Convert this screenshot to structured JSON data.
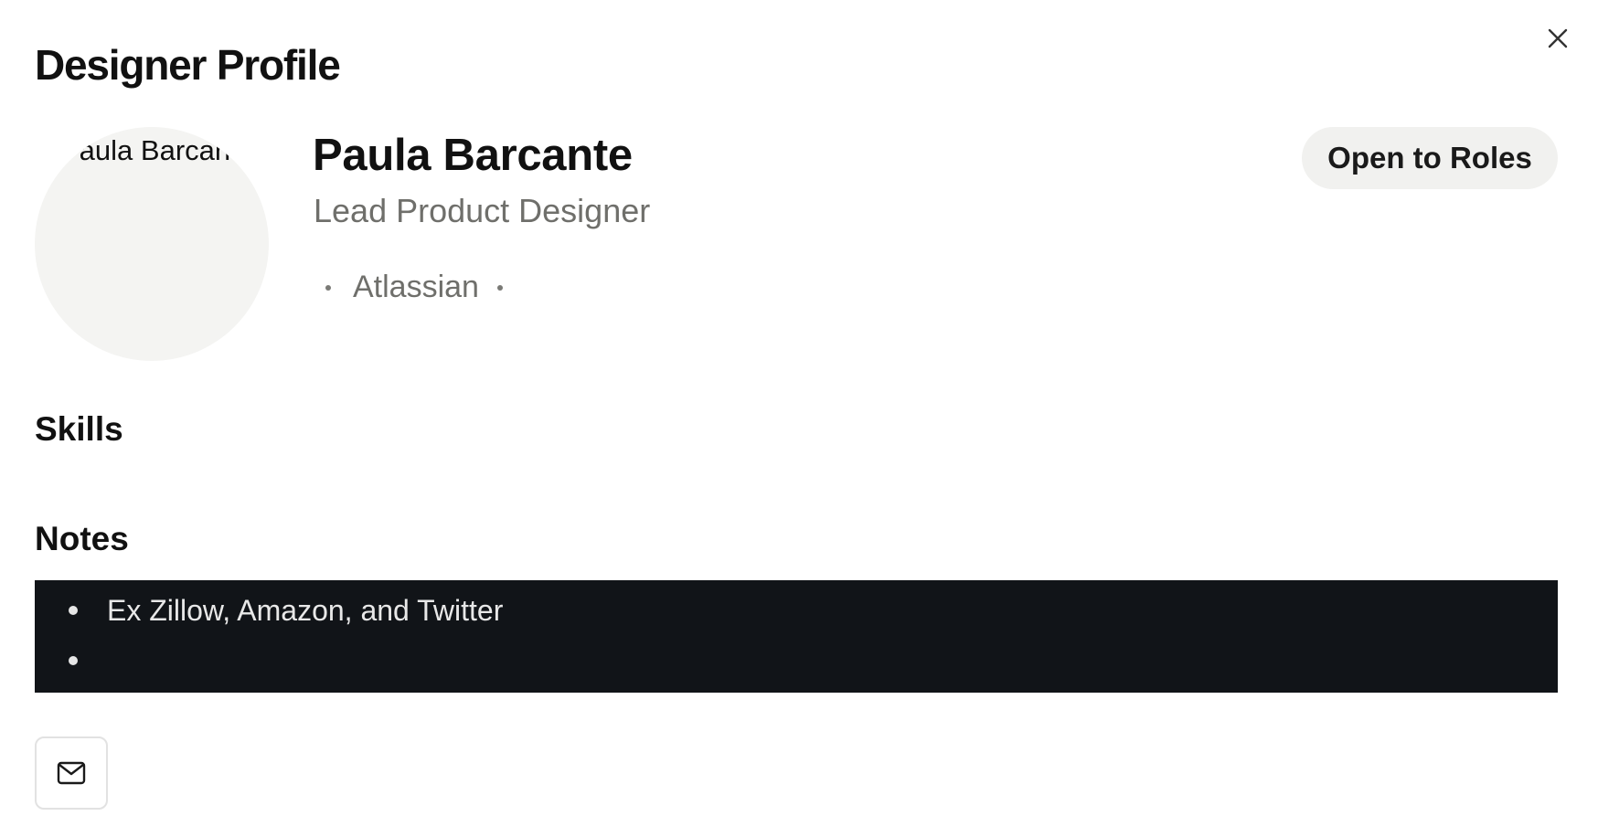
{
  "dialog": {
    "title": "Designer Profile",
    "close_icon": "close-icon"
  },
  "profile": {
    "avatar_alt": "Paula Barcante",
    "name": "Paula Barcante",
    "role": "Lead Product Designer",
    "company": "Atlassian",
    "status": "Open to Roles"
  },
  "skills": {
    "heading": "Skills",
    "items": []
  },
  "notes": {
    "heading": "Notes",
    "items": [
      "Ex Zillow, Amazon, and Twitter",
      ""
    ]
  },
  "actions": {
    "email_icon": "mail-icon"
  },
  "colors": {
    "notes_background": "#111418",
    "pill_background": "#f1f1ef",
    "avatar_background": "#f4f4f2",
    "muted_text": "#6f6f6b"
  }
}
